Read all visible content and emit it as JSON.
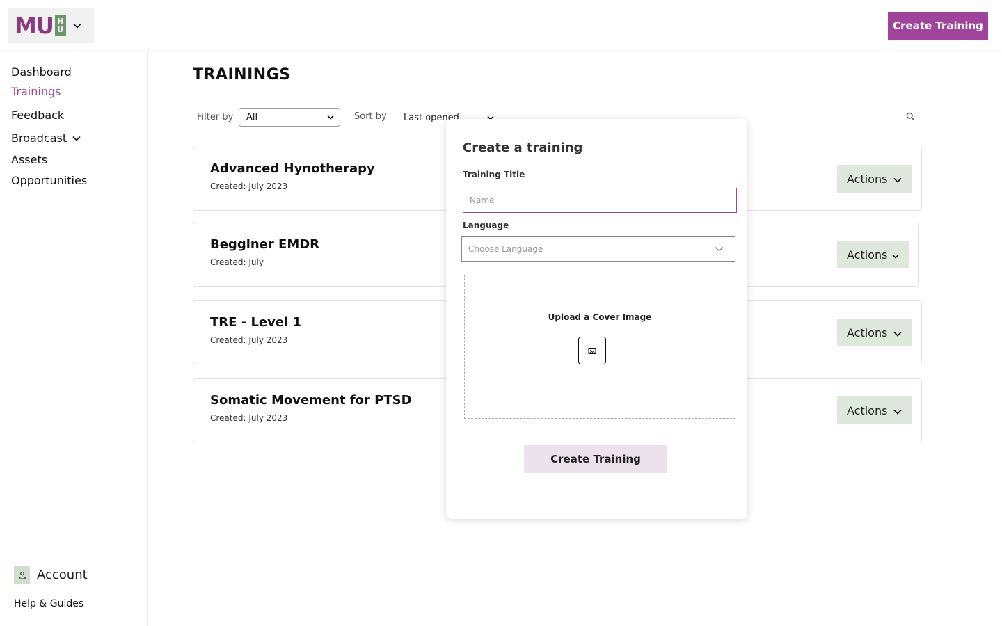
{
  "header": {
    "logo": {
      "mu": "MU",
      "hu_top": "H",
      "hu_bottom": "U"
    },
    "create_button": "Create Training"
  },
  "sidebar": {
    "items": [
      {
        "label": "Dashboard",
        "active": false
      },
      {
        "label": "Trainings",
        "active": true
      },
      {
        "label": "Feedback",
        "active": false
      },
      {
        "label": "Broadcast",
        "active": false,
        "expandable": true
      },
      {
        "label": "Assets",
        "active": false
      },
      {
        "label": "Opportunities",
        "active": false
      }
    ],
    "account": "Account",
    "help": "Help & Guides"
  },
  "main": {
    "title": "TRAININGS",
    "filter_label": "Filter by",
    "filter_value": "All",
    "sort_label": "Sort by",
    "sort_value": "Last opened",
    "trainings": [
      {
        "title": "Advanced Hynotherapy",
        "created": "Created: July 2023",
        "actions": "Actions"
      },
      {
        "title": "Begginer EMDR",
        "created": "Created: July",
        "actions": "Actions"
      },
      {
        "title": "TRE - Level 1",
        "created": "Created: July 2023",
        "actions": "Actions"
      },
      {
        "title": "Somatic Movement for PTSD",
        "created": "Created: July 2023",
        "actions": "Actions"
      }
    ]
  },
  "modal": {
    "title": "Create a training",
    "title_label": "Training Title",
    "title_placeholder": "Name",
    "language_label": "Language",
    "language_placeholder": "Choose Language",
    "upload_label": "Upload a Cover Image",
    "submit": "Create Training"
  },
  "colors": {
    "brand_purple": "#a0449b",
    "logo_green": "#6b9667",
    "actions_bg": "#dfe8dc",
    "submit_bg": "#ebe2ec"
  }
}
